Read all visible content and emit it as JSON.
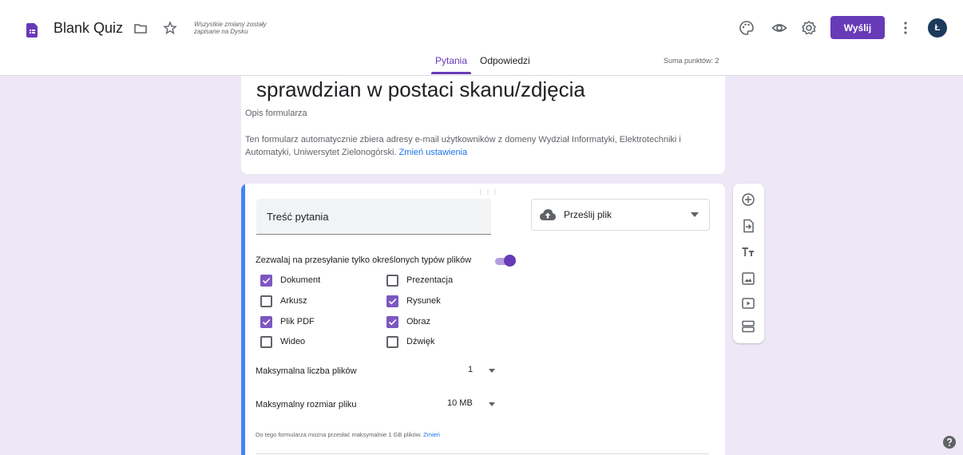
{
  "header": {
    "app_title": "Blank Quiz",
    "save_status": "Wszystkie zmiany zostały zapisane na Dysku",
    "send_label": "Wyślij",
    "avatar_initial": "Ł",
    "accent_color": "#673ab7"
  },
  "tabs": [
    {
      "label": "Pytania",
      "active": true
    },
    {
      "label": "Odpowiedzi",
      "active": false
    }
  ],
  "points_total": "Suma punktów: 2",
  "form": {
    "title": "sprawdzian w postaci skanu/zdjęcia",
    "description_placeholder": "Opis formularza",
    "email_note": "Ten formularz automatycznie zbiera adresy e-mail użytkowników z domeny Wydział Informatyki, Elektrotechniki i Automatyki, Uniwersytet Zielonogórski.",
    "email_link": "Zmień ustawienia"
  },
  "question": {
    "title_placeholder": "Treść pytania",
    "type_label": "Prześlij plik",
    "restrict_label": "Zezwalaj na przesyłanie tylko określonych typów plików",
    "restrict_enabled": true,
    "file_types": [
      {
        "label": "Dokument",
        "checked": true
      },
      {
        "label": "Prezentacja",
        "checked": false
      },
      {
        "label": "Arkusz",
        "checked": false
      },
      {
        "label": "Rysunek",
        "checked": true
      },
      {
        "label": "Plik PDF",
        "checked": true
      },
      {
        "label": "Obraz",
        "checked": true
      },
      {
        "label": "Wideo",
        "checked": false
      },
      {
        "label": "Dźwięk",
        "checked": false
      }
    ],
    "max_files_label": "Maksymalna liczba plików",
    "max_files_value": "1",
    "max_size_label": "Maksymalny rozmiar pliku",
    "max_size_value": "10 MB",
    "limit_note": "Do tego formularza można przesłać maksymalnie 1 GB plików.",
    "limit_link": "Zmień"
  },
  "toolbar_icons": [
    "add-question-icon",
    "import-questions-icon",
    "add-title-icon",
    "add-image-icon",
    "add-video-icon",
    "add-section-icon"
  ]
}
